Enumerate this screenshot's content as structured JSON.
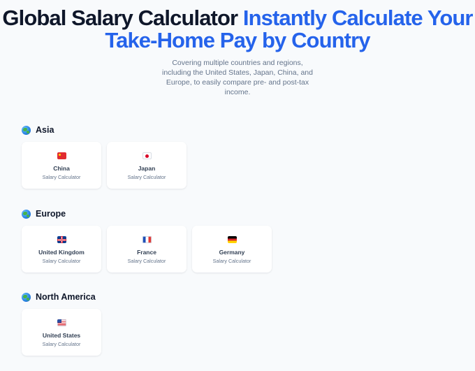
{
  "hero": {
    "title_main": "Global Salary Calculator",
    "title_accent": "Instantly Calculate Your Take-Home Pay by Country",
    "subtitle": "Covering multiple countries and regions, including the United States, Japan, China, and Europe, to easily compare pre- and post-tax income."
  },
  "sections": [
    {
      "title": "Asia",
      "icon": "globe-icon",
      "cards": [
        {
          "name": "China",
          "subtitle": "Salary Calculator",
          "flag": "china-flag-icon"
        },
        {
          "name": "Japan",
          "subtitle": "Salary Calculator",
          "flag": "japan-flag-icon"
        }
      ]
    },
    {
      "title": "Europe",
      "icon": "globe-icon",
      "cards": [
        {
          "name": "United Kingdom",
          "subtitle": "Salary Calculator",
          "flag": "united-kingdom-flag-icon"
        },
        {
          "name": "France",
          "subtitle": "Salary Calculator",
          "flag": "france-flag-icon"
        },
        {
          "name": "Germany",
          "subtitle": "Salary Calculator",
          "flag": "germany-flag-icon"
        }
      ]
    },
    {
      "title": "North America",
      "icon": "globe-icon",
      "cards": [
        {
          "name": "United States",
          "subtitle": "Salary Calculator",
          "flag": "united-states-flag-icon"
        }
      ]
    }
  ],
  "colors": {
    "background": "#f8fafc",
    "heading": "#0f172a",
    "accent": "#2563eb",
    "muted": "#64748b",
    "card": "#ffffff"
  }
}
